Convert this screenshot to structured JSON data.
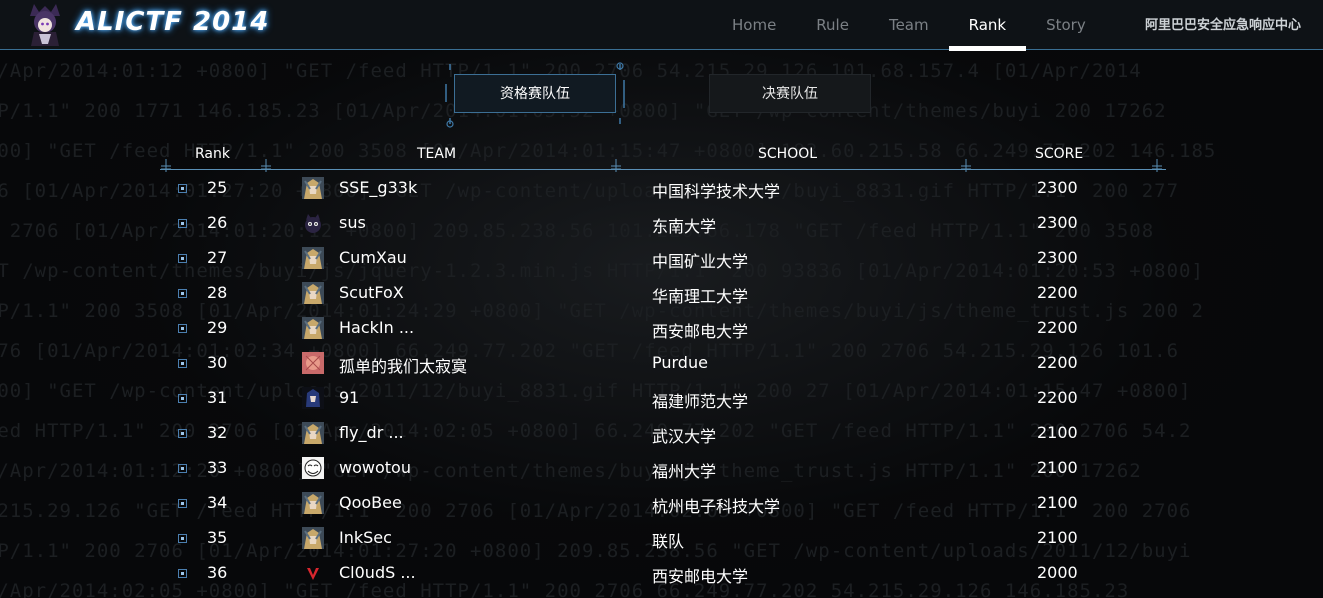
{
  "header": {
    "logo_text": "ALICTF 2014",
    "nav": [
      {
        "label": "Home"
      },
      {
        "label": "Rule"
      },
      {
        "label": "Team"
      },
      {
        "label": "Rank"
      },
      {
        "label": "Story"
      }
    ],
    "active_nav": "Rank",
    "org": "阿里巴巴安全应急响应中心"
  },
  "tabs": {
    "qualifier_label": "资格赛队伍",
    "final_label": "决赛队伍",
    "active": "qualifier"
  },
  "table": {
    "headers": {
      "rank": "Rank",
      "team": "TEAM",
      "school": "SCHOOL",
      "score": "SCORE"
    },
    "rows": [
      {
        "rank": "25",
        "team": "SSE_g33k",
        "school": "中国科学技术大学",
        "score": "2300",
        "avatar": "anime-avatar"
      },
      {
        "rank": "26",
        "team": "sus",
        "school": "东南大学",
        "score": "2300",
        "avatar": "cat-avatar"
      },
      {
        "rank": "27",
        "team": "CumXau",
        "school": "中国矿业大学",
        "score": "2300",
        "avatar": "anime-avatar"
      },
      {
        "rank": "28",
        "team": "ScutFoX",
        "school": "华南理工大学",
        "score": "2200",
        "avatar": "anime-avatar"
      },
      {
        "rank": "29",
        "team": "HackIn ...",
        "school": "西安邮电大学",
        "score": "2200",
        "avatar": "anime-avatar"
      },
      {
        "rank": "30",
        "team": "孤单的我们太寂寞",
        "school": "Purdue",
        "score": "2200",
        "avatar": "pink-avatar"
      },
      {
        "rank": "31",
        "team": "91",
        "school": "福建师范大学",
        "score": "2200",
        "avatar": "blue-hair-avatar"
      },
      {
        "rank": "32",
        "team": "fly_dr ...",
        "school": "武汉大学",
        "score": "2100",
        "avatar": "anime-avatar"
      },
      {
        "rank": "33",
        "team": "wowotou",
        "school": "福州大学",
        "score": "2100",
        "avatar": "meme-face-avatar"
      },
      {
        "rank": "34",
        "team": "QooBee",
        "school": "杭州电子科技大学",
        "score": "2100",
        "avatar": "anime-avatar"
      },
      {
        "rank": "35",
        "team": "InkSec",
        "school": "联队",
        "score": "2100",
        "avatar": "anime-avatar"
      },
      {
        "rank": "36",
        "team": "Cl0udS ...",
        "school": "西安邮电大学",
        "score": "2000",
        "avatar": "red-v-avatar"
      }
    ]
  },
  "colors": {
    "accent_line": "#3a6f93",
    "row_icon": "#5b8fc0",
    "background": "#060708"
  }
}
